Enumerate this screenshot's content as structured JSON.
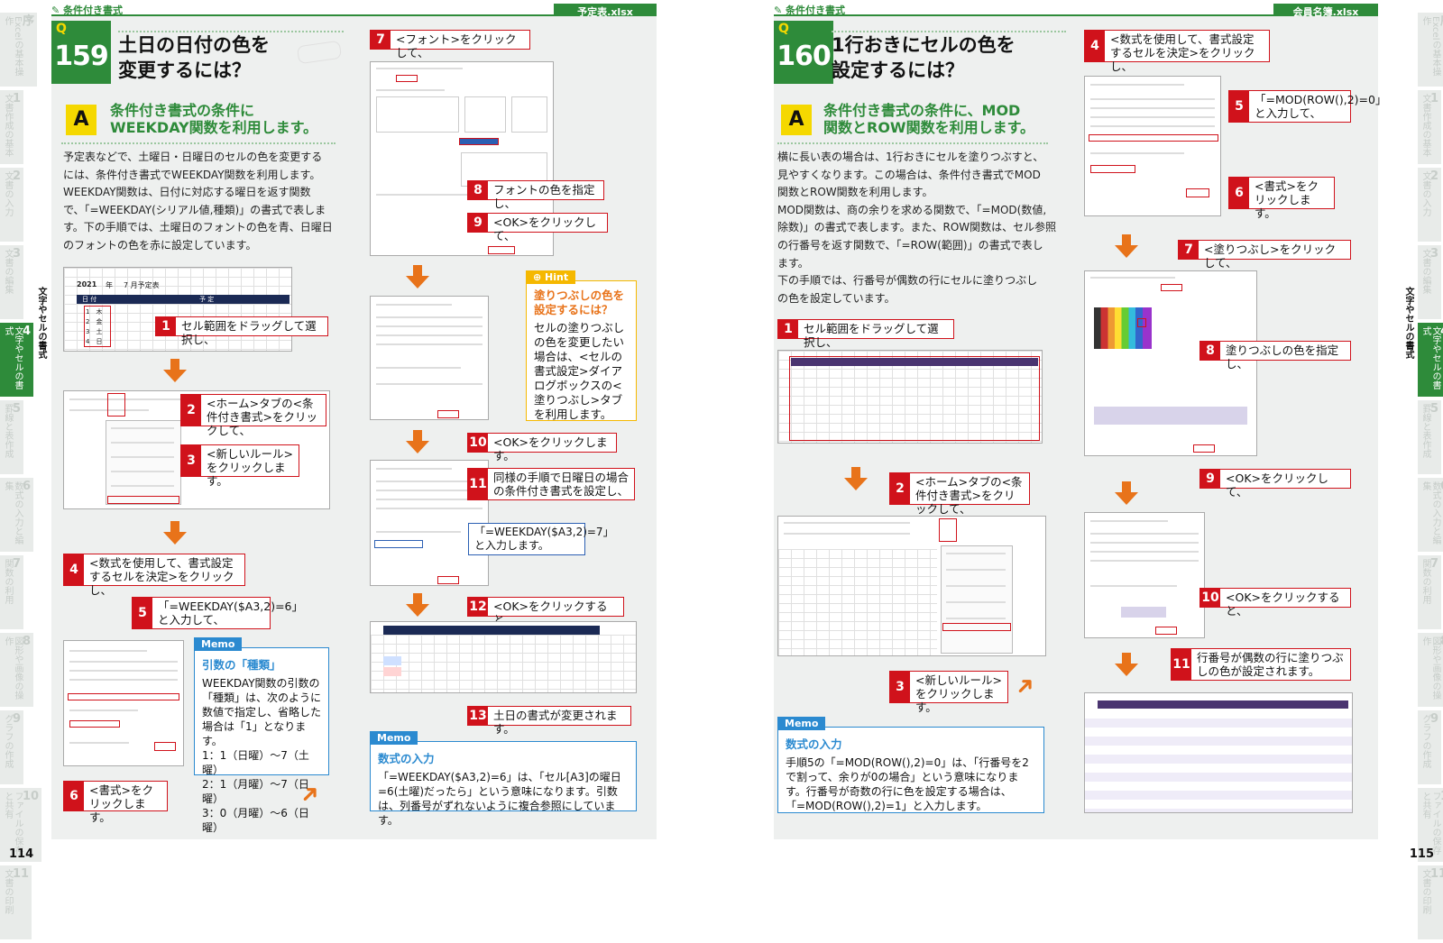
{
  "left": {
    "section": "条件付き書式",
    "file": "予定表.xlsx",
    "q_letter": "Q",
    "q_num": "159",
    "q_title_1": "土日の日付の色を",
    "q_title_2": "変更するには？",
    "a_letter": "A",
    "a_title_1": "条件付き書式の条件に",
    "a_title_2": "WEEKDAY関数を利用します。",
    "body": [
      "予定表などで、土曜日・日曜日のセルの色を変更する",
      "には、条件付き書式でWEEKDAY関数を利用します。",
      "WEEKDAY関数は、日付に対応する曜日を返す関数",
      "で、「=WEEKDAY(シリアル値,種類)」の書式で表しま",
      "す。下の手順では、土曜日のフォントの色を青、日曜日",
      "のフォントの色を赤に設定しています。"
    ],
    "steps": [
      {
        "n": "1",
        "t": "セル範囲をドラッグして選択し、"
      },
      {
        "n": "2",
        "t": "<ホーム>タブの<条件付き書式>をクリックして、"
      },
      {
        "n": "3",
        "t": "<新しいルール>をクリックします。"
      },
      {
        "n": "4",
        "t": "<数式を使用して、書式設定するセルを決定>をクリックし、"
      },
      {
        "n": "5",
        "t": "「=WEEKDAY($A3,2)=6」と入力して、"
      },
      {
        "n": "6",
        "t": "<書式>をクリックします。"
      },
      {
        "n": "7",
        "t": "<フォント>をクリックして、"
      },
      {
        "n": "8",
        "t": "フォントの色を指定し、"
      },
      {
        "n": "9",
        "t": "<OK>をクリックして、"
      },
      {
        "n": "10",
        "t": "<OK>をクリックします。"
      },
      {
        "n": "11",
        "t": "同様の手順で日曜日の場合の条件付き書式を設定し、"
      },
      {
        "n": "12",
        "t": "<OK>をクリックすると、"
      },
      {
        "n": "13",
        "t": "土日の書式が変更されます。"
      }
    ],
    "blue_note": "「=WEEKDAY($A3,2)=7」と入力します。",
    "memo1": {
      "tag": "Memo",
      "title": "引数の「種類」",
      "body": "WEEKDAY関数の引数の「種類」は、次のように数値で指定し、省略した場合は「1」となります。",
      "lines": [
        "1：1（日曜）～7（土曜）",
        "2：1（月曜）～7（日曜）",
        "3：0（月曜）～6（日曜）"
      ]
    },
    "hint": {
      "tag": "Hint",
      "title": "塗りつぶしの色を設定するには？",
      "body": "セルの塗りつぶしの色を変更したい場合は、<セルの書式設定>ダイアログボックスの<塗りつぶし>タブを利用します。"
    },
    "memo2": {
      "tag": "Memo",
      "title": "数式の入力",
      "body": "「=WEEKDAY($A3,2)=6」は、「セル[A3]の曜日=6(土曜)だったら」という意味になります。引数は、列番号がずれないように複合参照にしています。"
    },
    "page_num": "114",
    "sheet": {
      "year": "2021",
      "label": "年",
      "month": "7 月予定表",
      "col_a": "日 付",
      "col_b": "予 定",
      "rows": [
        [
          "1",
          "木"
        ],
        [
          "2",
          "金"
        ],
        [
          "3",
          "土"
        ],
        [
          "4",
          "日"
        ]
      ]
    }
  },
  "right": {
    "section": "条件付き書式",
    "file": "会員名簿.xlsx",
    "q_letter": "Q",
    "q_num": "160",
    "q_title_1": "1行おきにセルの色を",
    "q_title_2": "設定するには？",
    "a_letter": "A",
    "a_title_1": "条件付き書式の条件に、MOD",
    "a_title_2": "関数とROW関数を利用します。",
    "body": [
      "横に長い表の場合は、1行おきにセルを塗りつぶすと、",
      "見やすくなります。この場合は、条件付き書式でMOD",
      "関数とROW関数を利用します。",
      "MOD関数は、商の余りを求める関数で、「=MOD(数値,",
      "除数)」の書式で表します。また、ROW関数は、セル参照",
      "の行番号を返す関数で、「=ROW(範囲)」の書式で表し",
      "ます。",
      "下の手順では、行番号が偶数の行にセルに塗りつぶし",
      "の色を設定しています。"
    ],
    "steps": [
      {
        "n": "1",
        "t": "セル範囲をドラッグして選択し、"
      },
      {
        "n": "2",
        "t": "<ホーム>タブの<条件付き書式>をクリックして、"
      },
      {
        "n": "3",
        "t": "<新しいルール>をクリックします。"
      },
      {
        "n": "4",
        "t": "<数式を使用して、書式設定するセルを決定>をクリックし、"
      },
      {
        "n": "5",
        "t": "「=MOD(ROW(),2)=0」と入力して、"
      },
      {
        "n": "6",
        "t": "<書式>をクリックします。"
      },
      {
        "n": "7",
        "t": "<塗りつぶし>をクリックして、"
      },
      {
        "n": "8",
        "t": "塗りつぶしの色を指定し、"
      },
      {
        "n": "9",
        "t": "<OK>をクリックして、"
      },
      {
        "n": "10",
        "t": "<OK>をクリックすると、"
      },
      {
        "n": "11",
        "t": "行番号が偶数の行に塗りつぶしの色が設定されます。"
      }
    ],
    "memo": {
      "tag": "Memo",
      "title": "数式の入力",
      "body": "手順5の「=MOD(ROW(),2)=0」は、「行番号を2で割って、余りが0の場合」という意味になります。行番号が奇数の行に色を設定する場合は、「=MOD(ROW(),2)=1」と入力します。"
    },
    "page_num": "115"
  },
  "tabs": [
    {
      "n": "序",
      "t": "Excelの基本操作"
    },
    {
      "n": "1",
      "t": "文書作成の基本"
    },
    {
      "n": "2",
      "t": "文書の入力"
    },
    {
      "n": "3",
      "t": "文書の編集"
    },
    {
      "n": "4",
      "t": "文字やセルの書式"
    },
    {
      "n": "5",
      "t": "罫線と表作成"
    },
    {
      "n": "6",
      "t": "数式の入力と編集"
    },
    {
      "n": "7",
      "t": "関数の利用"
    },
    {
      "n": "8",
      "t": "図形や画像の操作"
    },
    {
      "n": "9",
      "t": "グラフの作成"
    },
    {
      "n": "10",
      "t": "ファイルの保存と共有"
    },
    {
      "n": "11",
      "t": "文書の印刷"
    }
  ],
  "active_label": "文字やセルの書式",
  "colors": {
    "green": "#2e8b3a",
    "red": "#d0121b",
    "orange": "#e8731a",
    "blue": "#2b8ad0",
    "yellow": "#f5d800"
  }
}
